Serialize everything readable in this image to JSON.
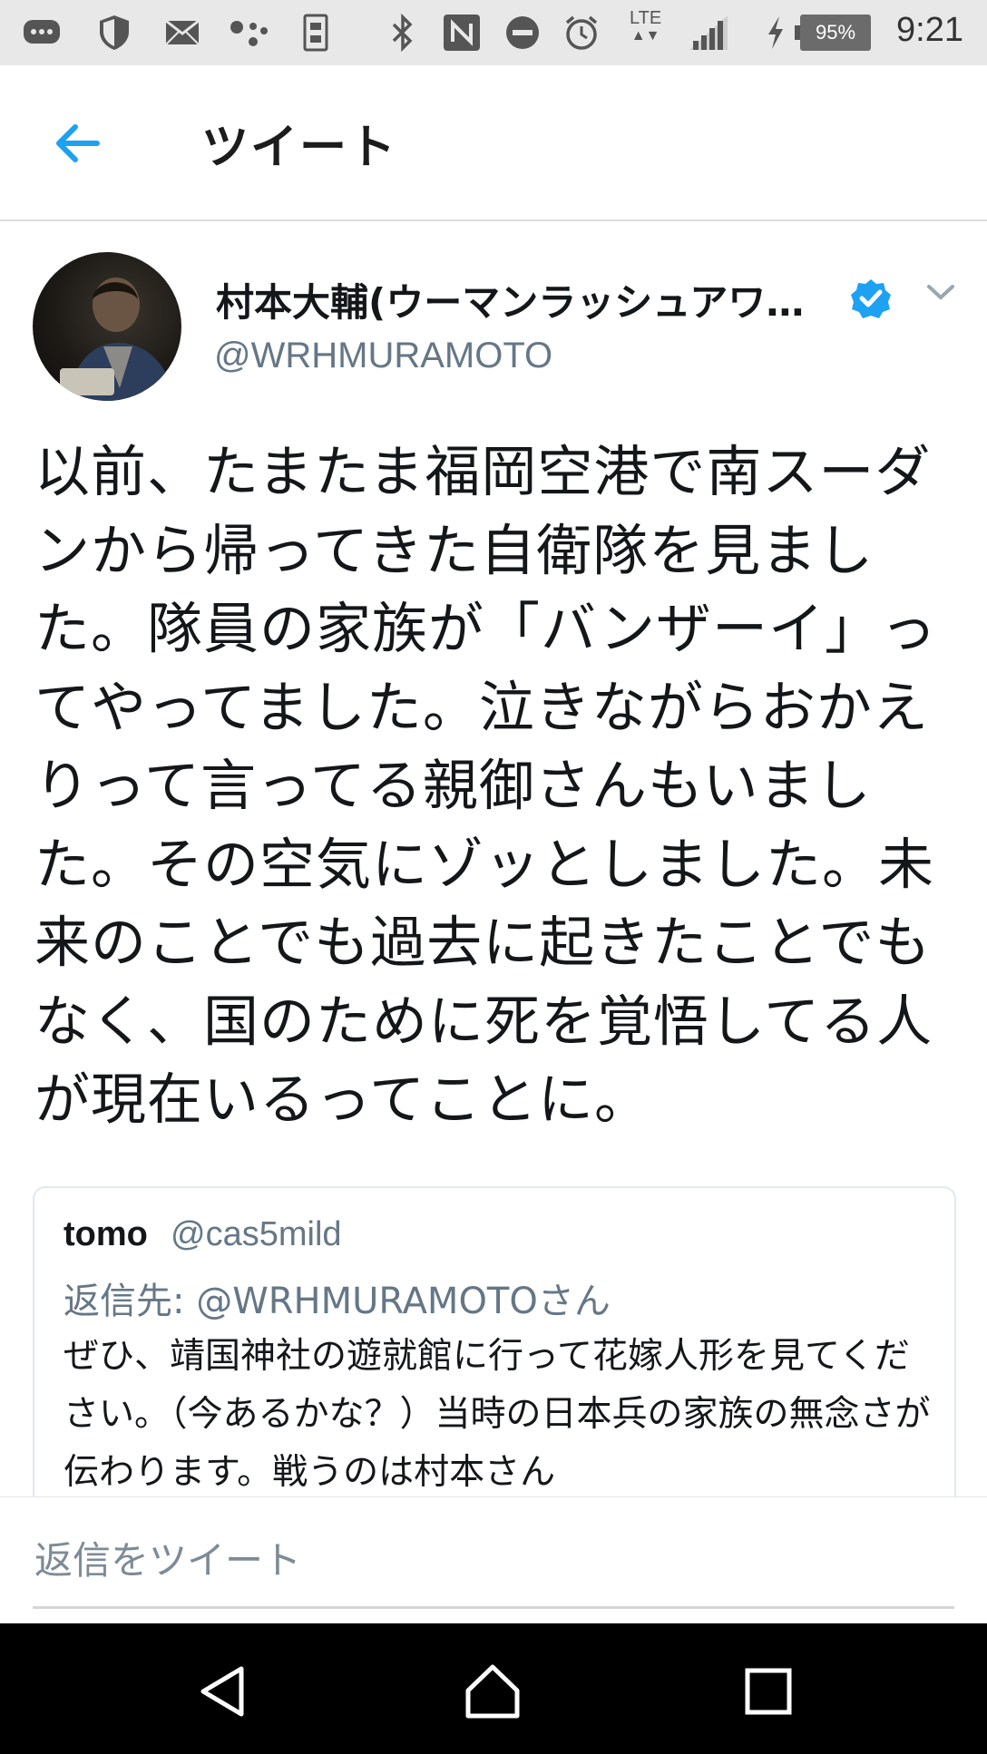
{
  "status_bar": {
    "network": "LTE",
    "battery": "95%",
    "time": "9:21",
    "icons": [
      "messenger-icon",
      "shield-icon",
      "mail-icon",
      "assistant-icon",
      "sim-icon",
      "bluetooth-icon",
      "nfc-icon",
      "dnd-icon",
      "alarm-icon",
      "signal-icon",
      "charging-icon",
      "battery-icon"
    ]
  },
  "header": {
    "title": "ツイート",
    "back_icon": "back-arrow-icon"
  },
  "tweet": {
    "user_name": "村本大輔(ウーマンラッシュアワ…",
    "user_handle": "@WRHMURAMOTO",
    "verified": true,
    "text": "以前、たまたま福岡空港で南スーダンから帰ってきた自衛隊を見ました。隊員の家族が「バンザーイ」ってやってました。泣きながらおかえりって言ってる親御さんもいました。その空気にゾッとしました。未来のことでも過去に起きたことでもなく、国のために死を覚悟してる人が現在いるってことに。"
  },
  "quoted_tweet": {
    "name": "tomo",
    "handle": "@cas5mild",
    "reply_to": "返信先: @WRHMURAMOTOさん",
    "text": "ぜひ、靖国神社の遊就館に行って花嫁人形を見てください。（今あるかな？）当時の日本兵の家族の無念さが伝わります。戦うのは村本さん"
  },
  "reply": {
    "placeholder": "返信をツイート"
  },
  "colors": {
    "accent": "#1da1f2",
    "secondary_text": "#657786",
    "status_bar_bg": "#e8e8e8",
    "nav_bar_bg": "#000000"
  }
}
